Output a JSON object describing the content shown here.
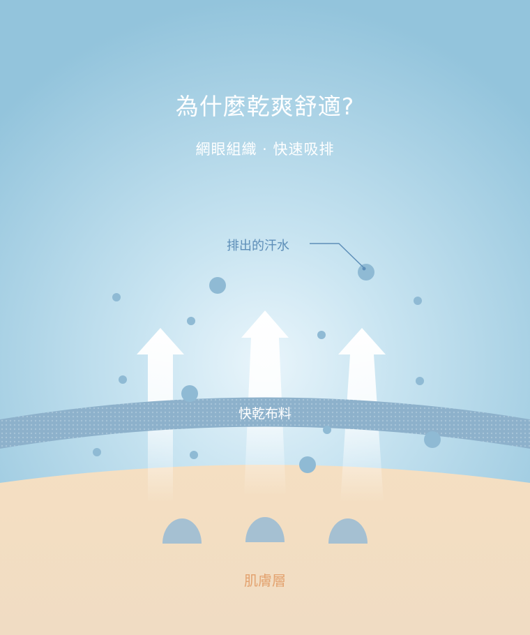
{
  "header": {
    "title": "為什麼乾爽舒適?",
    "subtitle": "網眼組織 · 快速吸排"
  },
  "diagram": {
    "sweat_label": "排出的汗水",
    "fabric_label": "快乾布料",
    "skin_label": "肌膚層"
  },
  "colors": {
    "sky": "#9dcbe2",
    "fabric": "#8eb2cc",
    "skin": "#f1dcc0",
    "droplet": "#8fbad4",
    "skin_label": "#e3a26f",
    "sweat_label": "#5d8eb8"
  }
}
